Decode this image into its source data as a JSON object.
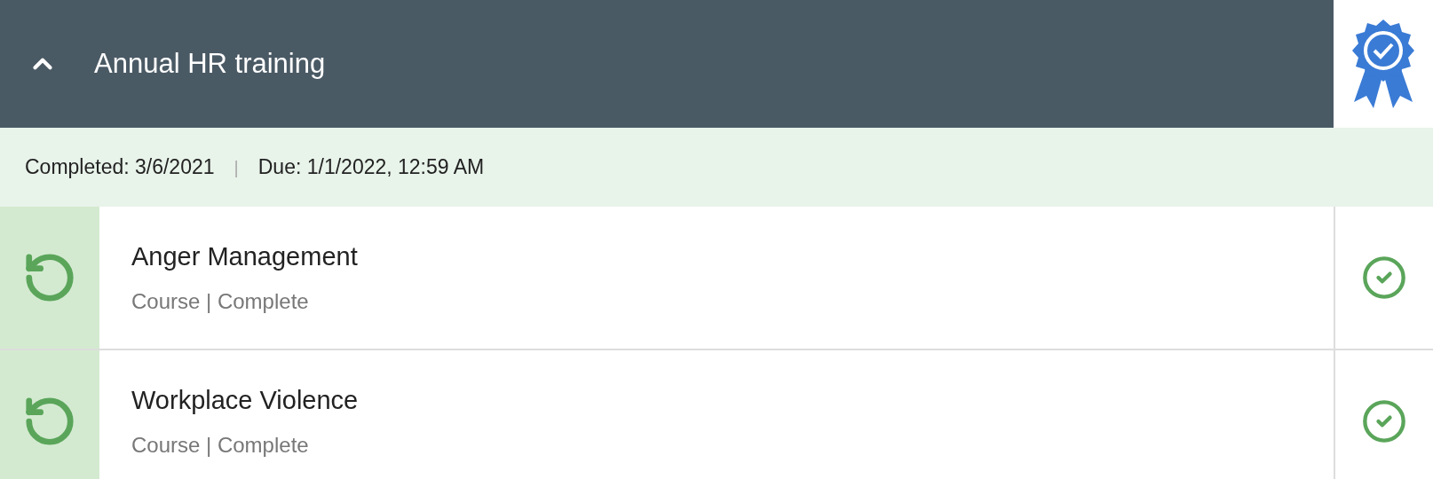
{
  "header": {
    "title": "Annual HR training",
    "expanded": true,
    "certified": true
  },
  "status": {
    "completed": "Completed: 3/6/2021",
    "separator": "|",
    "due": "Due: 1/1/2022, 12:59 AM"
  },
  "items": [
    {
      "title": "Anger Management",
      "subtitle": "Course | Complete",
      "completed": true
    },
    {
      "title": "Workplace Violence",
      "subtitle": "Course | Complete",
      "completed": true
    }
  ]
}
